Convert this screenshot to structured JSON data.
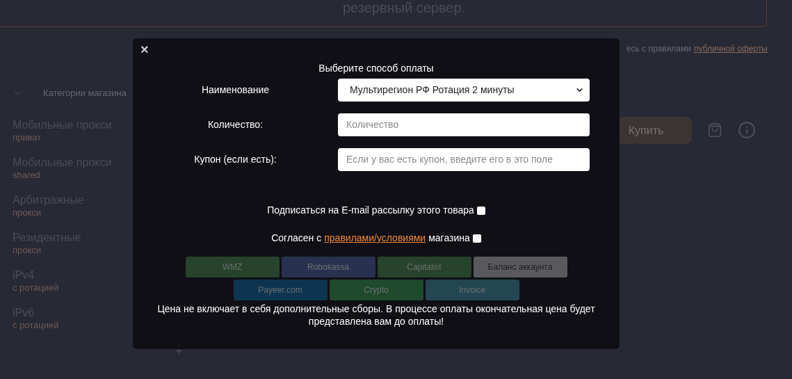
{
  "background": {
    "notice": "резервный сервер.",
    "offer_text": "есь с правилами",
    "offer_link": "публичной оферты",
    "category_toggle": "Категории магазина",
    "sidebar": [
      {
        "title": "Мобильные прокси",
        "subtitle": "приват"
      },
      {
        "title": "Мобильные прокси",
        "subtitle": "shared"
      },
      {
        "title": "Арбитражные",
        "subtitle": "прокси"
      },
      {
        "title": "Резидентные",
        "subtitle": "прокси"
      },
      {
        "title": "iPv4",
        "subtitle": "с ротацией"
      },
      {
        "title": "iPv6",
        "subtitle": "с ротацией"
      }
    ],
    "plus": "+",
    "buy_button": "Купить"
  },
  "modal": {
    "close": "×",
    "title": "Выберите способ оплаты",
    "fields": [
      {
        "kind": "select",
        "label": "Наименование",
        "value": "Мультирегион РФ Ротация 2 минуты"
      },
      {
        "kind": "input",
        "label": "Количество:",
        "placeholder": "Количество"
      },
      {
        "kind": "input",
        "label": "Купон (если есть):",
        "placeholder": "Если у вас есть купон, введите его в это поле"
      }
    ],
    "subscribe": {
      "label": "Подписаться на E-mail рассылку этого товара",
      "checked": false
    },
    "agree": {
      "before": "Согласен с",
      "link": "правилами/условиями",
      "after": "магазина",
      "checked": false
    },
    "payment_rows": [
      [
        {
          "label": "WMZ",
          "color": "#27432b"
        },
        {
          "label": "Robokassa",
          "color": "#283250"
        },
        {
          "label": "Capitalist",
          "color": "#27432b"
        },
        {
          "label": "Баланс аккаунта",
          "color": "#5a595e"
        }
      ],
      [
        {
          "label": "Payeer.com",
          "color": "#0d3550"
        },
        {
          "label": "Crypto",
          "color": "#1f4a2c"
        },
        {
          "label": "Invoice",
          "color": "#244652"
        }
      ]
    ],
    "note": "Цена не включает в себя дополнительные сборы. В процессе оплаты окончательная цена будет представлена вам до оплаты!"
  }
}
